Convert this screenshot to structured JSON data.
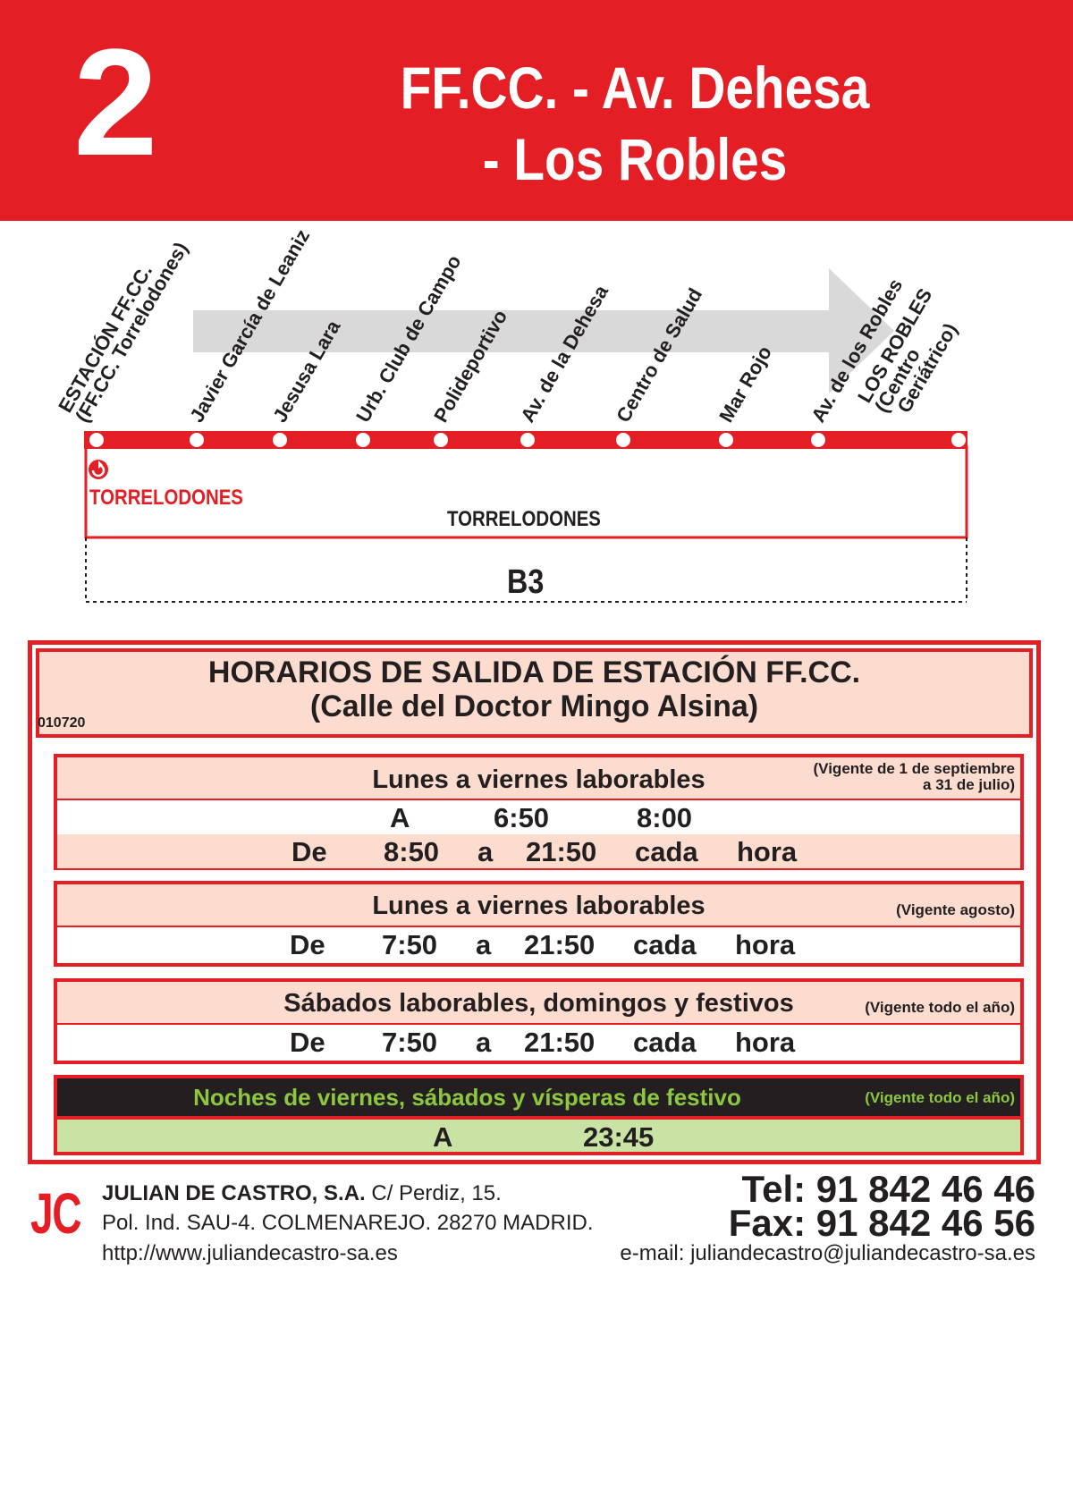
{
  "header": {
    "line_number": "2",
    "title_line1": "FF.CC. - Av. Dehesa",
    "title_line2": "- Los Robles"
  },
  "route_map": {
    "stops": [
      {
        "label": "ESTACIÓN FF.CC.\n(FF.CC. Torrelodones)"
      },
      {
        "label": "Javier García de Leaniz"
      },
      {
        "label": "Jesusa Lara"
      },
      {
        "label": "Urb. Club de Campo"
      },
      {
        "label": "Polideportivo"
      },
      {
        "label": "Av. de la Dehesa"
      },
      {
        "label": "Centro de Salud"
      },
      {
        "label": "Mar Rojo"
      },
      {
        "label": "Av. de los Robles"
      },
      {
        "label": "LOS ROBLES\n(Centro\n  Geriátrico)"
      }
    ],
    "zone_red": "TORRELODONES",
    "zone_black": "TORRELODONES",
    "fare_zone": "B3",
    "colors": {
      "line": "#e31e24",
      "arrow": "#d9d9d9"
    }
  },
  "schedule": {
    "title": "HORARIOS DE SALIDA DE ESTACIÓN FF.CC.",
    "subtitle": "(Calle del Doctor Mingo Alsina)",
    "code": "010720",
    "blocks": [
      {
        "title": "Lunes a viernes laborables",
        "note": "(Vigente de 1 de septiembre\na 31 de julio)",
        "row1": {
          "a": "A",
          "t1": "6:50",
          "t2": "8:00"
        },
        "row2": {
          "de": "De",
          "from": "8:50",
          "a": "a",
          "to": "21:50",
          "cada": "cada",
          "hora": "hora"
        }
      },
      {
        "title": "Lunes a viernes laborables",
        "note": "(Vigente agosto)",
        "row": {
          "de": "De",
          "from": "7:50",
          "a": "a",
          "to": "21:50",
          "cada": "cada",
          "hora": "hora"
        }
      },
      {
        "title": "Sábados laborables, domingos y festivos",
        "note": "(Vigente todo el año)",
        "row": {
          "de": "De",
          "from": "7:50",
          "a": "a",
          "to": "21:50",
          "cada": "cada",
          "hora": "hora"
        }
      },
      {
        "title": "Noches de viernes, sábados y vísperas de festivo",
        "note": "(Vigente todo el año)",
        "row": {
          "a": "A",
          "time": "23:45"
        }
      }
    ]
  },
  "footer": {
    "logo": "JC",
    "company": "JULIAN DE CASTRO, S.A.",
    "address1": " C/ Perdiz, 15.",
    "address2": "Pol. Ind. SAU-4. COLMENAREJO. 28270 MADRID.",
    "web": "http://www.juliandecastro-sa.es",
    "tel": "Tel: 91 842 46 46",
    "fax": "Fax: 91 842 46 56",
    "email": "e-mail: juliandecastro@juliandecastro-sa.es"
  }
}
